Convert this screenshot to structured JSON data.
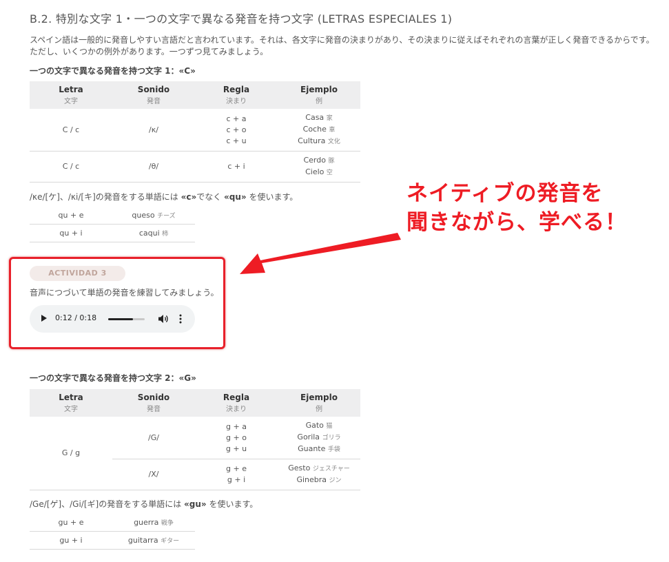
{
  "heading": "B.2. 特別な文字 1・一つの文字で異なる発音を持つ文字 (LETRAS ESPECIALES 1)",
  "intro": [
    "スペイン語は一般的に発音しやすい言語だと言われています。それは、各文字に発音の決まりがあり、その決まりに従えばそれぞれの言葉が正しく発音できるからです。",
    "ただし、いくつかの例外があります。一つずつ見てみましょう。"
  ],
  "section_c": {
    "title": "一つの文字で異なる発音を持つ文字 1：«C»",
    "headers": [
      {
        "es": "Letra",
        "jp": "文字"
      },
      {
        "es": "Sonido",
        "jp": "発音"
      },
      {
        "es": "Regla",
        "jp": "決まり"
      },
      {
        "es": "Ejemplo",
        "jp": "例"
      }
    ],
    "rows": [
      {
        "letra": "C / c",
        "sonido": "/κ/",
        "reglas": [
          "c + a",
          "c + o",
          "c + u"
        ],
        "ejemplos": [
          {
            "es": "Casa",
            "jp": "家"
          },
          {
            "es": "Coche",
            "jp": "車"
          },
          {
            "es": "Cultura",
            "jp": "文化"
          }
        ]
      },
      {
        "letra": "C / c",
        "sonido": "/θ/",
        "reglas": [
          "c + i"
        ],
        "ejemplos": [
          {
            "es": "Cerdo",
            "jp": "豚"
          },
          {
            "es": "Cielo",
            "jp": "空"
          }
        ]
      }
    ],
    "note_parts": [
      "/κe/[ケ]、/κi/[キ]の発音をする単語には ",
      "«c»",
      "でなく ",
      "«qu»",
      " を使います。"
    ],
    "small_rows": [
      {
        "rule": "qu + e",
        "word": "queso",
        "jp": "チーズ"
      },
      {
        "rule": "qu + i",
        "word": "caqui",
        "jp": "柿"
      }
    ]
  },
  "activity": {
    "label": "ACTIVIDAD 3",
    "instruction": "音声につづいて単語の発音を練習してみましょう。",
    "time": "0:12 / 0:18",
    "progress": 0.67
  },
  "callout": {
    "lines": [
      "ネイティブの発音を",
      "聞きながら、学べる！"
    ],
    "color": "#ee1c24"
  },
  "section_g": {
    "title": "一つの文字で異なる発音を持つ文字 2：«G»",
    "headers": [
      {
        "es": "Letra",
        "jp": "文字"
      },
      {
        "es": "Sonido",
        "jp": "発音"
      },
      {
        "es": "Regla",
        "jp": "決まり"
      },
      {
        "es": "Ejemplo",
        "jp": "例"
      }
    ],
    "letra": "G / g",
    "rows": [
      {
        "sonido": "/G/",
        "reglas": [
          "g + a",
          "g + o",
          "g + u"
        ],
        "ejemplos": [
          {
            "es": "Gato",
            "jp": "猫"
          },
          {
            "es": "Gorila",
            "jp": "ゴリラ"
          },
          {
            "es": "Guante",
            "jp": "手袋"
          }
        ]
      },
      {
        "sonido": "/X/",
        "reglas": [
          "g + e",
          "g + i"
        ],
        "ejemplos": [
          {
            "es": "Gesto",
            "jp": "ジェスチャー"
          },
          {
            "es": "Ginebra",
            "jp": "ジン"
          }
        ]
      }
    ],
    "note_parts": [
      "/Ge/[ゲ]、/Gi/[ギ]の発音をする単語には ",
      "«gu»",
      " を使います。"
    ],
    "small_rows": [
      {
        "rule": "gu + e",
        "word": "guerra",
        "jp": "戦争"
      },
      {
        "rule": "gu + i",
        "word": "guitarra",
        "jp": "ギター"
      }
    ]
  },
  "icons": {
    "play": "play-icon",
    "volume": "volume-icon",
    "menu": "more-vert-icon",
    "arrow": "arrow-icon"
  }
}
